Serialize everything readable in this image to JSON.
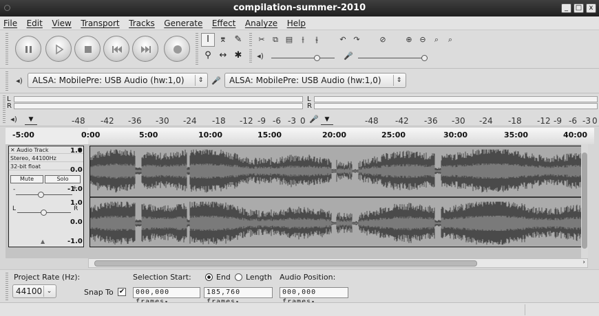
{
  "window": {
    "title": "compilation-summer-2010",
    "controls": [
      "_",
      "□",
      "x"
    ]
  },
  "menu": [
    "File",
    "Edit",
    "View",
    "Transport",
    "Tracks",
    "Generate",
    "Effect",
    "Analyze",
    "Help"
  ],
  "transport": [
    "pause",
    "play",
    "stop",
    "skip-to-start",
    "skip-to-end",
    "record"
  ],
  "devices": {
    "playback": "ALSA: MobilePre: USB Audio (hw:1,0)",
    "recording": "ALSA: MobilePre: USB Audio (hw:1,0)"
  },
  "meters": {
    "left_label": "L",
    "right_label": "R",
    "ticks": [
      "-48",
      "-42",
      "-36",
      "-30",
      "-24",
      "-18",
      "-12",
      "-9",
      "-6",
      "-3",
      "0"
    ]
  },
  "ruler": {
    "labels": [
      "-5:00",
      "0:00",
      "5:00",
      "10:00",
      "15:00",
      "20:00",
      "25:00",
      "30:00",
      "35:00",
      "40:00"
    ]
  },
  "track": {
    "name": "Audio Track",
    "format": "Stereo, 44100Hz",
    "bitdepth": "32-bit float",
    "mute": "Mute",
    "solo": "Solo",
    "pan_left": "L",
    "pan_right": "R",
    "gain_minus": "-",
    "gain_plus": "+",
    "scale_top": "1.0",
    "scale_mid": "0.0",
    "scale_bottom": "-1.0"
  },
  "selection": {
    "project_rate_label": "Project Rate (Hz):",
    "project_rate": "44100",
    "snap_to": "Snap To",
    "selection_start_label": "Selection Start:",
    "end_label": "End",
    "length_label": "Length",
    "audio_position_label": "Audio Position:",
    "start_value": "000,000 frames",
    "end_value": "185,760 frames",
    "position_value": "000,000 frames"
  },
  "colors": {
    "waveform": "#4a4a4a",
    "waveform_rms": "#7a7a7a",
    "track_bg": "#ababab"
  }
}
